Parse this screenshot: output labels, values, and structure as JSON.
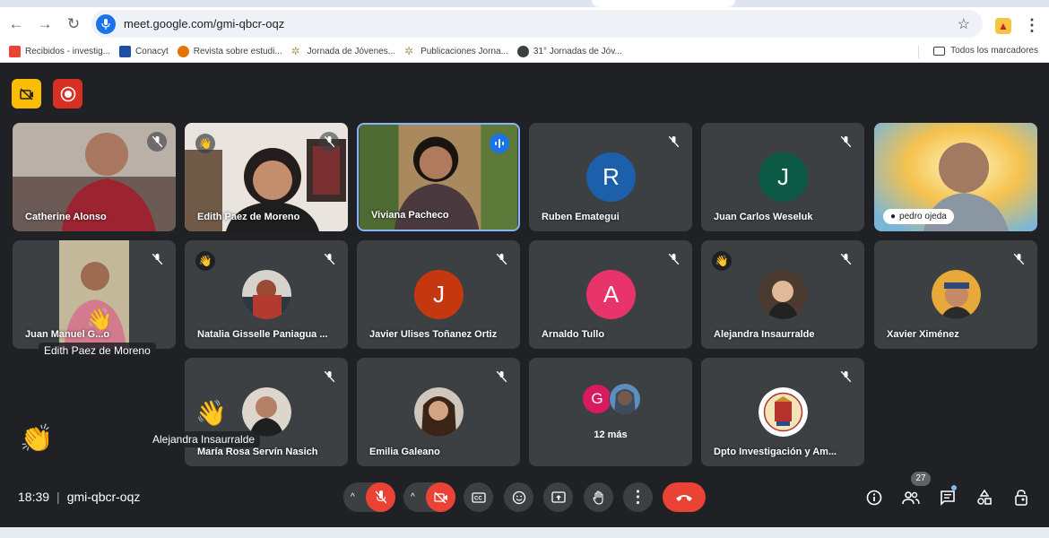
{
  "browser": {
    "url": "meet.google.com/gmi-qbcr-oqz",
    "bookmarks": [
      {
        "label": "Recibidos - investig...",
        "icon": "gmail-icon",
        "color": "#ea4335"
      },
      {
        "label": "Conacyt",
        "icon": "conacyt-icon",
        "color": "#1e4ea1"
      },
      {
        "label": "Revista sobre estudi...",
        "icon": "journal-icon",
        "color": "#e37400"
      },
      {
        "label": "Jornada de Jóvenes...",
        "icon": "sun-icon",
        "color": "#9aa0a6"
      },
      {
        "label": "Publicaciones Jorna...",
        "icon": "sun-icon",
        "color": "#9aa0a6"
      },
      {
        "label": "31° Jornadas de Jóv...",
        "icon": "globe-icon",
        "color": "#3c4043"
      }
    ],
    "all_bookmarks": "Todos los marcadores"
  },
  "participants": [
    {
      "name": "Catherine Alonso",
      "type": "photo",
      "muted": true
    },
    {
      "name": "Edith Paez de Moreno",
      "type": "photo",
      "muted": true,
      "hand": true
    },
    {
      "name": "Viviana Pacheco",
      "type": "photo",
      "muted": false,
      "speaking": true
    },
    {
      "name": "Ruben Emategui",
      "type": "initial",
      "initial": "R",
      "color": "#1c5fab",
      "muted": true
    },
    {
      "name": "Juan Carlos Weseluk",
      "type": "initial",
      "initial": "J",
      "color": "#0c5a45",
      "muted": true
    },
    {
      "name": "pedro ojeda",
      "type": "photo",
      "muted": false,
      "pinned": true
    },
    {
      "name": "Juan Manuel G...o",
      "type": "photo",
      "muted": true
    },
    {
      "name": "Natalia Gisselle Paniagua ...",
      "type": "avatar",
      "muted": true,
      "hand": true
    },
    {
      "name": "Javier Ulises Toñanez Ortiz",
      "type": "initial",
      "initial": "J",
      "color": "#c5380f",
      "muted": true
    },
    {
      "name": "Arnaldo Tullo",
      "type": "initial",
      "initial": "A",
      "color": "#e8336b",
      "muted": true
    },
    {
      "name": "Alejandra Insaurralde",
      "type": "avatar",
      "muted": true,
      "hand": true
    },
    {
      "name": "Xavier Ximénez",
      "type": "avatar",
      "muted": true
    },
    {
      "name": "María Rosa Servín Nasich",
      "type": "avatar",
      "muted": true
    },
    {
      "name": "Emilia Galeano",
      "type": "avatar",
      "muted": true
    },
    {
      "name": "12 más",
      "type": "more",
      "initial": "G"
    },
    {
      "name": "Dpto Investigación y Am...",
      "type": "avatar",
      "muted": true
    }
  ],
  "overlays": {
    "reaction_name_1": "Edith Paez de Moreno",
    "reaction_name_2": "Alejandra Insaurralde"
  },
  "meeting": {
    "time": "18:39",
    "separator": "|",
    "code": "gmi-qbcr-oqz",
    "people_count": "27"
  },
  "colors": {
    "background": "#202124",
    "tile": "#3c4043",
    "danger": "#ea4335",
    "accent": "#8ab4f8",
    "record_red": "#d93025",
    "captions_yellow": "#fbbc04"
  }
}
